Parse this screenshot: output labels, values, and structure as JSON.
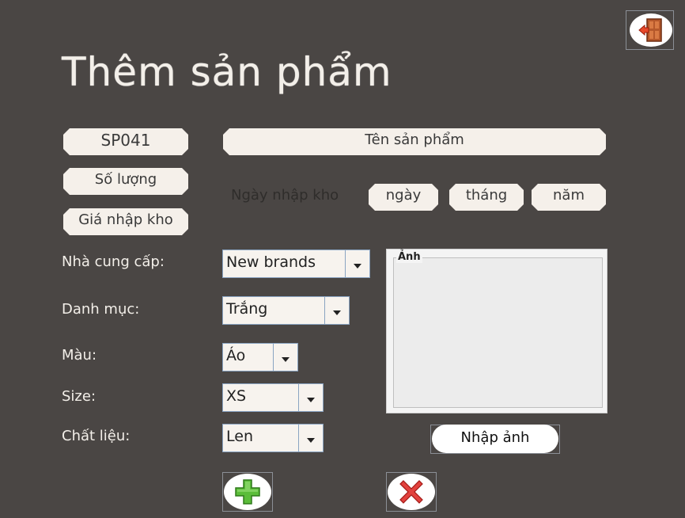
{
  "title": "Thêm sản phẩm",
  "fields": {
    "product_id": "SP041",
    "product_name_placeholder": "Tên sản phẩm",
    "quantity_placeholder": "Số lượng",
    "import_price_placeholder": "Giá nhập kho"
  },
  "import_date": {
    "label": "Ngày nhập kho",
    "day": "ngày",
    "month": "tháng",
    "year": "năm"
  },
  "form": {
    "supplier": {
      "label": "Nhà cung cấp:",
      "value": "New brands"
    },
    "category": {
      "label": "Danh mục:",
      "value": "Trắng"
    },
    "color": {
      "label": "Màu:",
      "value": "Áo"
    },
    "size": {
      "label": "Size:",
      "value": "XS"
    },
    "material": {
      "label": "Chất liệu:",
      "value": "Len"
    }
  },
  "image_panel": {
    "caption": "Ảnh"
  },
  "buttons": {
    "import_image": "Nhập ảnh"
  },
  "icons": {
    "exit": "door-exit-icon",
    "add": "plus-icon",
    "cancel": "x-icon"
  },
  "colors": {
    "background": "#4a4644",
    "field": "#f5f0ea",
    "plus_green": "#5bbd3a",
    "x_red": "#e2413d"
  }
}
